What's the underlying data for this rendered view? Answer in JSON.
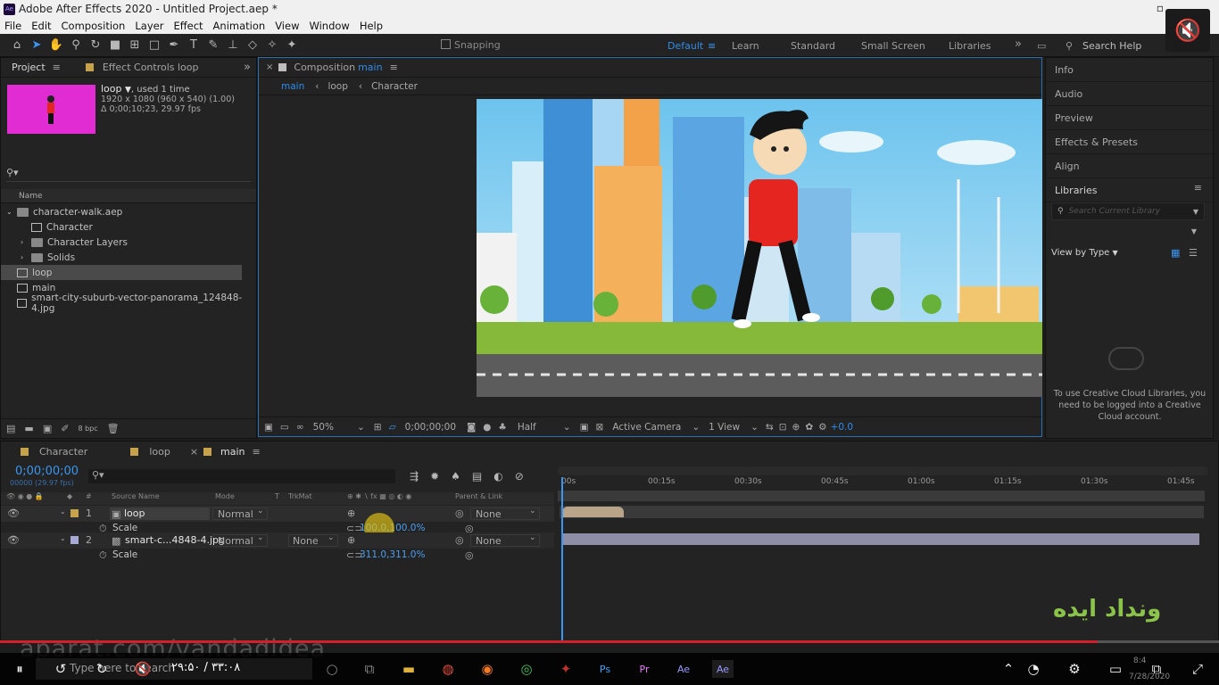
{
  "window": {
    "title": "Adobe After Effects 2020 - Untitled Project.aep *",
    "logo": "Ae"
  },
  "menu": [
    "File",
    "Edit",
    "Composition",
    "Layer",
    "Effect",
    "Animation",
    "View",
    "Window",
    "Help"
  ],
  "toolbar": {
    "snapping": "Snapping"
  },
  "workspaces": [
    "Default",
    "Learn",
    "Standard",
    "Small Screen",
    "Libraries"
  ],
  "search_help": "Search Help",
  "project": {
    "tab_project": "Project",
    "tab_effect_controls": "Effect Controls loop",
    "item_name": "loop",
    "used": ", used 1 time",
    "dims": "1920 x 1080  (960 x 540) (1.00)",
    "duration": "Δ 0;00;10;23, 29.97 fps",
    "column_name": "Name",
    "items": [
      {
        "label": "character-walk.aep",
        "kind": "folder",
        "level": 0
      },
      {
        "label": "Character",
        "kind": "comp",
        "level": 1
      },
      {
        "label": "Character Layers",
        "kind": "folder",
        "level": 1
      },
      {
        "label": "Solids",
        "kind": "folder",
        "level": 1
      },
      {
        "label": "loop",
        "kind": "comp",
        "level": 0,
        "selected": true
      },
      {
        "label": "main",
        "kind": "comp",
        "level": 0
      },
      {
        "label": "smart-city-suburb-vector-panorama_124848-4.jpg",
        "kind": "image",
        "level": 0
      }
    ],
    "bpc": "8 bpc"
  },
  "composition": {
    "tab_prefix": "Composition",
    "tab_name": "main",
    "breadcrumbs": [
      "main",
      "loop",
      "Character"
    ],
    "zoom": "50%",
    "timecode": "0;00;00;00",
    "resolution": "Half",
    "camera": "Active Camera",
    "views": "1 View",
    "exposure": "+0.0"
  },
  "right_panels": [
    "Info",
    "Audio",
    "Preview",
    "Effects & Presets",
    "Align"
  ],
  "libraries": {
    "title": "Libraries",
    "search_placeholder": "Search Current Library",
    "view_by": "View by Type",
    "message": "To use Creative Cloud Libraries, you need to be logged into a Creative Cloud account."
  },
  "timeline": {
    "tabs": [
      "Character",
      "loop",
      "main"
    ],
    "timecode": "0;00;00;00",
    "fps": "00000 (29.97 fps)",
    "columns": {
      "source": "Source Name",
      "mode": "Mode",
      "t": "T",
      "trkmat": "TrkMat",
      "parent": "Parent & Link"
    },
    "ruler": [
      "00s",
      "00:15s",
      "00:30s",
      "00:45s",
      "01:00s",
      "01:15s",
      "01:30s",
      "01:45s"
    ],
    "layers": [
      {
        "num": "1",
        "name": "loop",
        "mode": "Normal",
        "trkmat": "",
        "parent": "None",
        "prop": "Scale",
        "value": "100.0,100.0%"
      },
      {
        "num": "2",
        "name": "smart-c...4848-4.jpg",
        "mode": "Normal",
        "trkmat": "None",
        "parent": "None",
        "prop": "Scale",
        "value": "311.0,311.0%"
      }
    ]
  },
  "watermark": {
    "url": "aparat.com/vandadidea",
    "logo": "ونداد ایده"
  },
  "player": {
    "time": "۲۹:۵۰ / ۳۳:۰۸",
    "search": "Type here to search",
    "date": "7/28/2020",
    "clock": "8:4"
  },
  "colors": {
    "accent": "#2d8ceb",
    "comp_label": "#e02cd2",
    "shirt": "#e52620",
    "progress": "#d1202a"
  }
}
